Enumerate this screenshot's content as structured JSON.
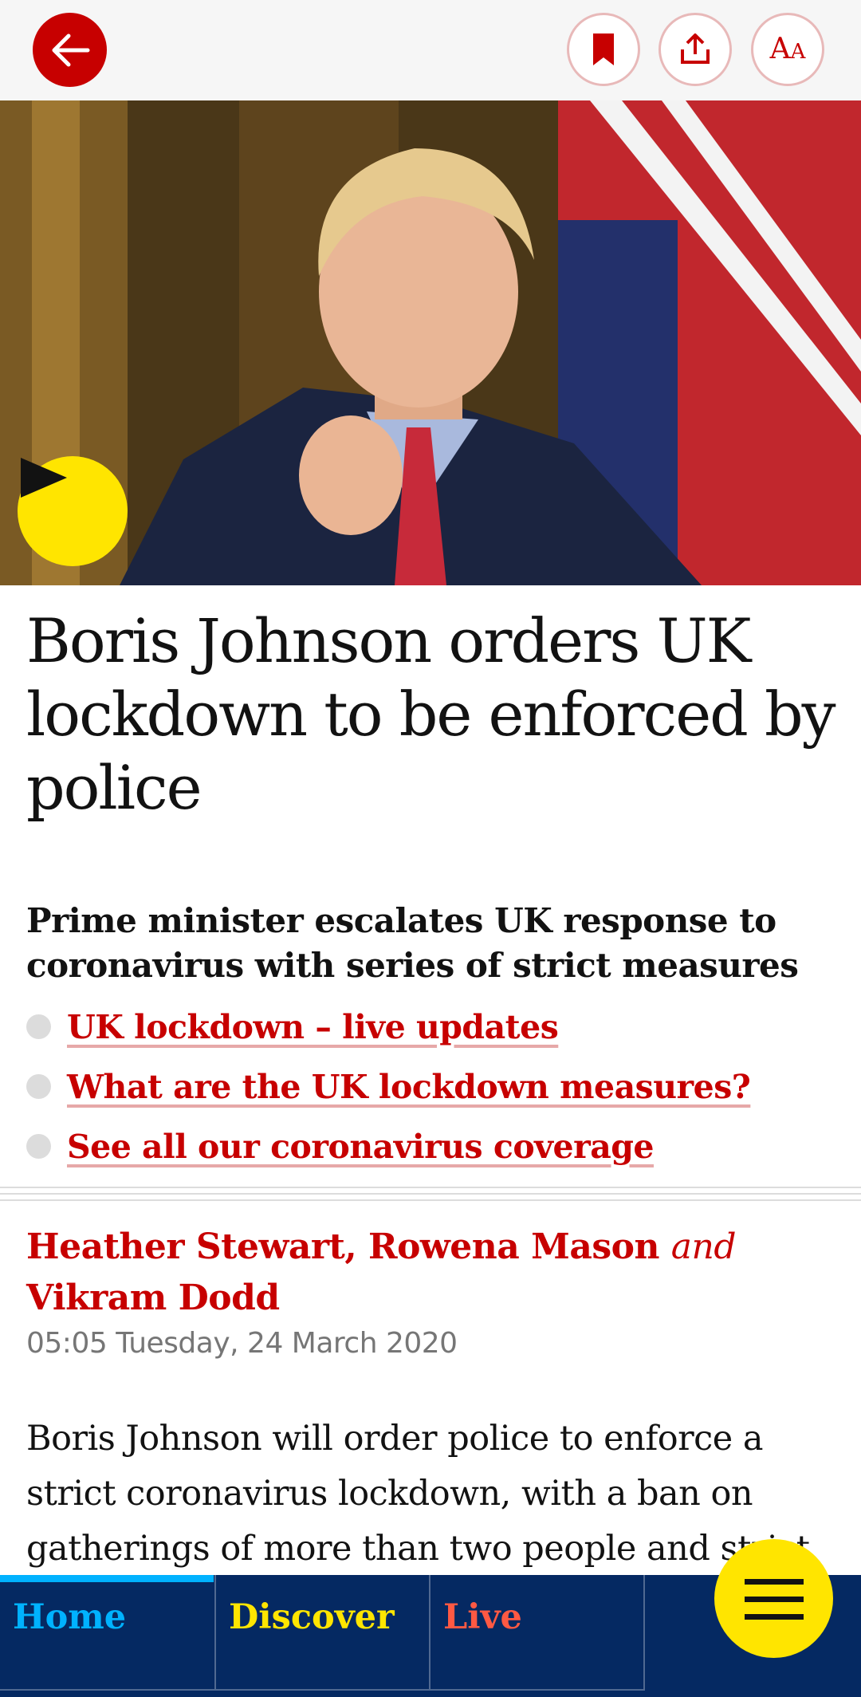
{
  "toolbar": {
    "back_icon": "arrow-left-icon",
    "bookmark_icon": "bookmark-icon",
    "share_icon": "share-icon",
    "text_size_label_large": "A",
    "text_size_label_small": "A"
  },
  "hero": {
    "play_icon": "play-icon"
  },
  "article": {
    "headline": "Boris Johnson orders UK lockdown to be enforced by police",
    "standfirst": "Prime minister escalates UK response to coronavirus with series of strict measures",
    "related_links": [
      "UK lockdown – live updates",
      "What are the UK lockdown measures?",
      "See all our coronavirus coverage"
    ],
    "byline": {
      "author1": "Heather Stewart",
      "sep1": ", ",
      "author2": "Rowena Mason",
      "and": "and",
      "author3": "Vikram Dodd"
    },
    "dateline": "05:05 Tuesday, 24 March 2020",
    "body": "Boris Johnson will order police to enforce a strict coronavirus lockdown, with a ban on gatherings of more than two people and strict"
  },
  "bottom_nav": {
    "home": "Home",
    "discover": "Discover",
    "live": "Live",
    "menu_icon": "hamburger-menu-icon"
  },
  "colors": {
    "brand_red": "#c70000",
    "nav_blue": "#052962",
    "yellow": "#ffe500",
    "home_accent": "#00b2ff",
    "live_accent": "#ff5943"
  }
}
